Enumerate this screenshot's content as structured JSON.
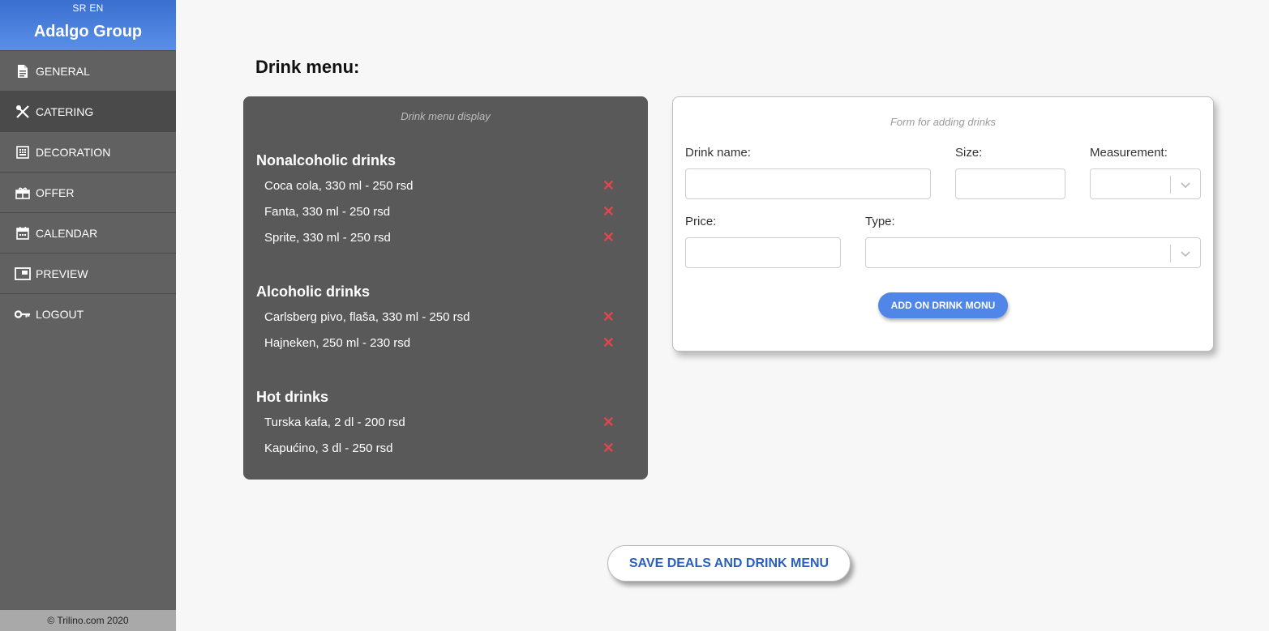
{
  "sidebar": {
    "languages": [
      "SR",
      "EN"
    ],
    "brand": "Adalgo Group",
    "items": [
      {
        "label": "GENERAL",
        "icon": "document-icon"
      },
      {
        "label": "CATERING",
        "icon": "fork-knife-icon",
        "active": true
      },
      {
        "label": "DECORATION",
        "icon": "decoration-icon"
      },
      {
        "label": "OFFER",
        "icon": "gift-icon"
      },
      {
        "label": "CALENDAR",
        "icon": "calendar-icon"
      },
      {
        "label": "PREVIEW",
        "icon": "preview-icon"
      },
      {
        "label": "LOGOUT",
        "icon": "key-icon"
      }
    ],
    "footer": "© Trilino.com 2020"
  },
  "main": {
    "title": "Drink menu:",
    "menu_panel": {
      "caption": "Drink menu display",
      "sections": [
        {
          "title": "Nonalcoholic drinks",
          "items": [
            "Coca cola, 330 ml - 250 rsd",
            "Fanta, 330 ml - 250 rsd",
            "Sprite, 330 ml - 250 rsd"
          ]
        },
        {
          "title": "Alcoholic drinks",
          "items": [
            "Carlsberg pivo, flaša, 330 ml - 250 rsd",
            "Hajneken, 250 ml - 230 rsd"
          ]
        },
        {
          "title": "Hot drinks",
          "items": [
            "Turska kafa, 2 dl - 200 rsd",
            "Kapućino, 3 dl - 250 rsd"
          ]
        }
      ],
      "delete_glyph": "✕"
    },
    "form": {
      "caption": "Form for adding drinks",
      "drink_name_label": "Drink name:",
      "drink_name_value": "",
      "size_label": "Size:",
      "size_value": "",
      "measurement_label": "Measurement:",
      "measurement_value": "",
      "price_label": "Price:",
      "price_value": "",
      "type_label": "Type:",
      "type_value": "",
      "add_button": "ADD ON DRINK MONU"
    },
    "save_button": "SAVE DEALS AND DRINK MENU"
  },
  "colors": {
    "brand_gradient_top": "#3a6fd0",
    "sidebar_bg": "#616161",
    "panel_bg": "#595959",
    "delete": "#e0474c",
    "accent": "#4f86e8"
  }
}
